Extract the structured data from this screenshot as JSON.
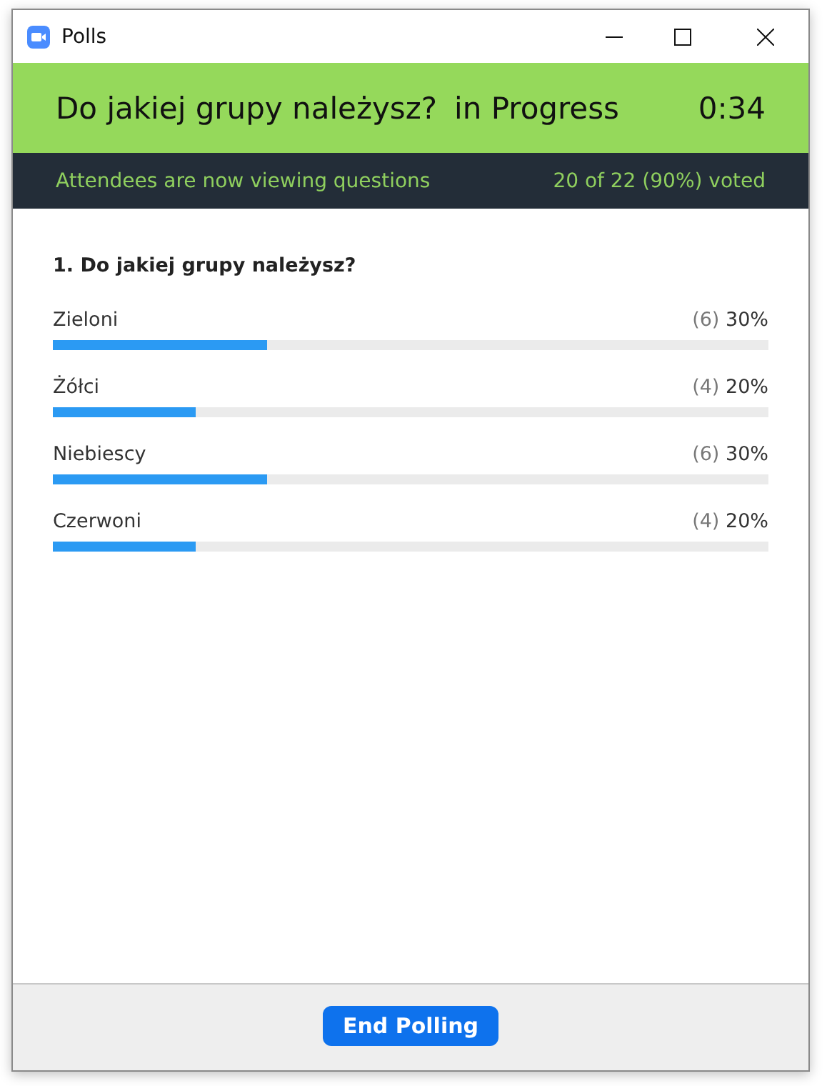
{
  "window": {
    "title": "Polls"
  },
  "header": {
    "title": "Do jakiej grupy należysz?",
    "status": "in Progress",
    "timer": "0:34"
  },
  "status_bar": {
    "message": "Attendees are now viewing questions",
    "votes": "20 of 22 (90%) voted"
  },
  "question": {
    "title": "1. Do jakiej grupy należysz?",
    "answers": [
      {
        "label": "Zieloni",
        "count": "(6)",
        "percent": "30%",
        "level": 0.3
      },
      {
        "label": "Żółci",
        "count": "(4)",
        "percent": "20%",
        "level": 0.2
      },
      {
        "label": "Niebiescy",
        "count": "(6)",
        "percent": "30%",
        "level": 0.3
      },
      {
        "label": "Czerwoni",
        "count": "(4)",
        "percent": "20%",
        "level": 0.2
      }
    ]
  },
  "footer": {
    "button": "End Polling"
  }
}
